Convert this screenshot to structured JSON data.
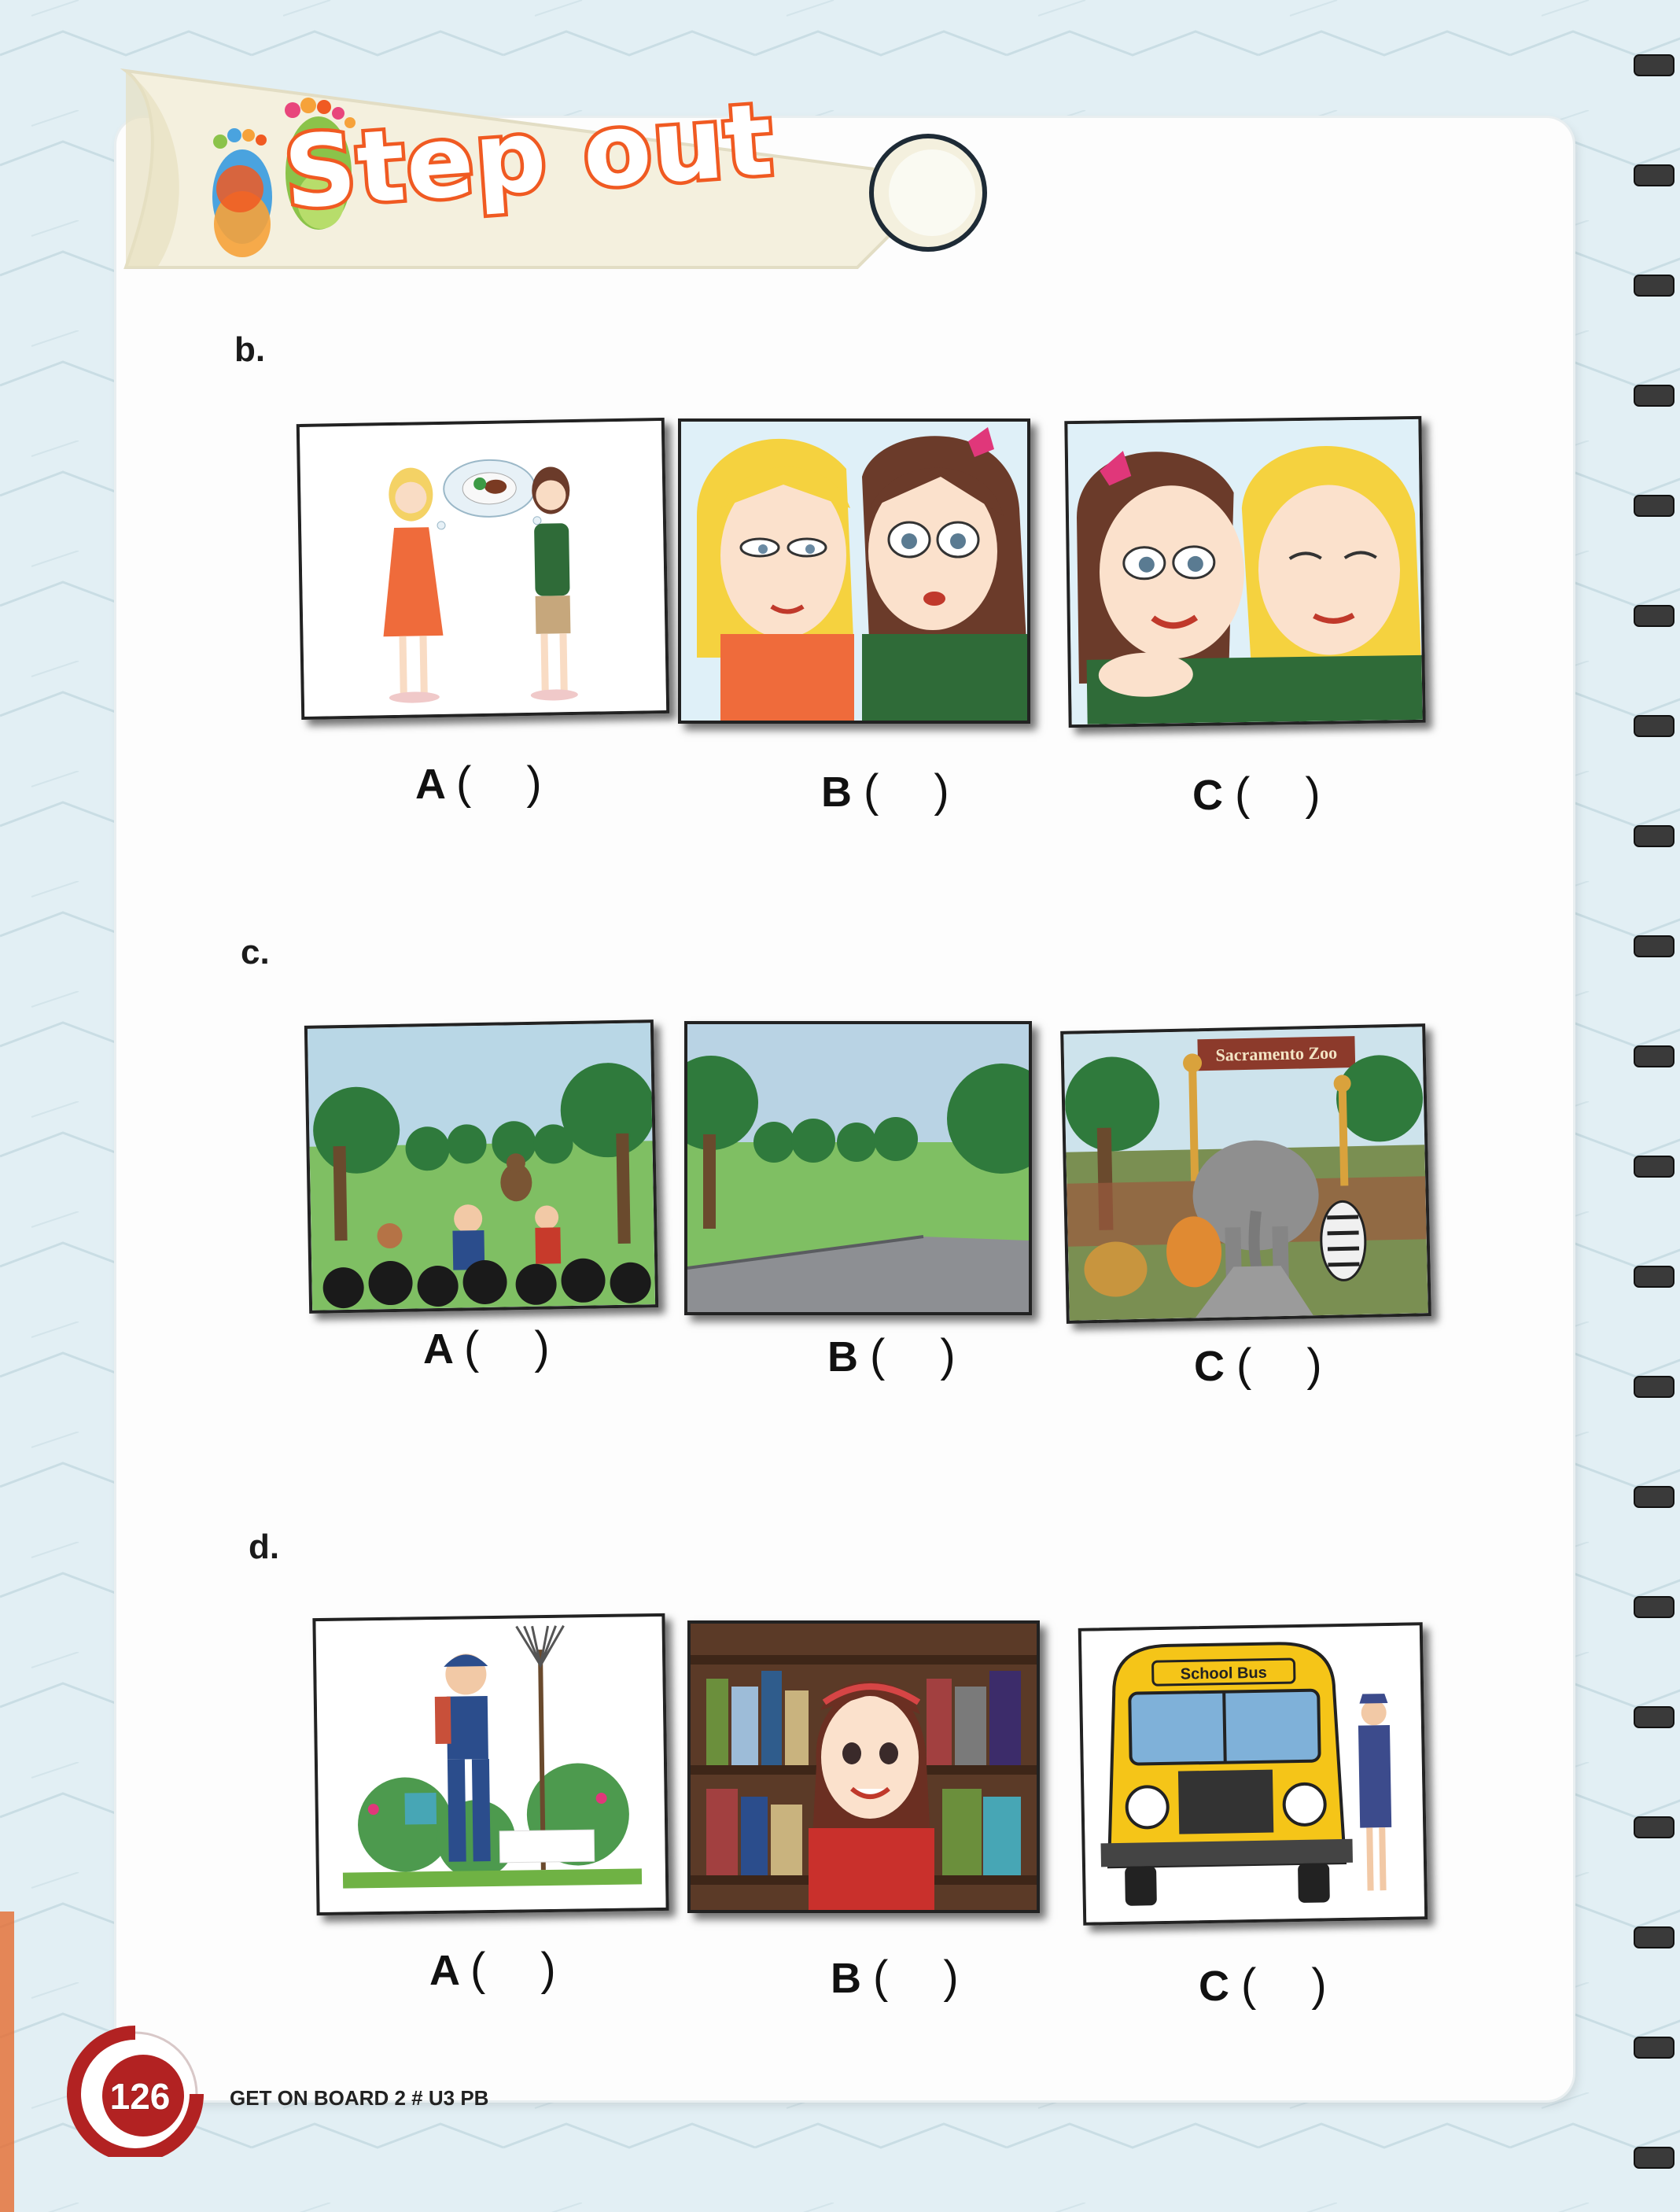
{
  "banner": {
    "title": "Step out"
  },
  "questions": [
    {
      "label": "b.",
      "options": [
        "A",
        "B",
        "C"
      ],
      "images": [
        "two girls thinking about a plate of food",
        "close-up of two girls looking doubtful",
        "close-up of two smiling girls hugging"
      ]
    },
    {
      "label": "c.",
      "options": [
        "A",
        "B",
        "C"
      ],
      "images": [
        "children watching a monkey in a park",
        "empty park with a path",
        "zoo with elephant, giraffes, tigers, lions and zebra"
      ],
      "zoo_sign": "Sacramento Zoo"
    },
    {
      "label": "d.",
      "options": [
        "A",
        "B",
        "C"
      ],
      "images": [
        "gardener holding a rake and watering can",
        "girl in front of bookshelves",
        "yellow school bus with a driver"
      ],
      "bus_sign": "School Bus"
    }
  ],
  "footer": {
    "page_number": "126",
    "book": "GET ON BOARD 2",
    "separator": "#",
    "section": "U3 PB"
  },
  "colors": {
    "accent": "#f05a22",
    "badge": "#b22222"
  },
  "icons": [
    "footprints-icon"
  ]
}
